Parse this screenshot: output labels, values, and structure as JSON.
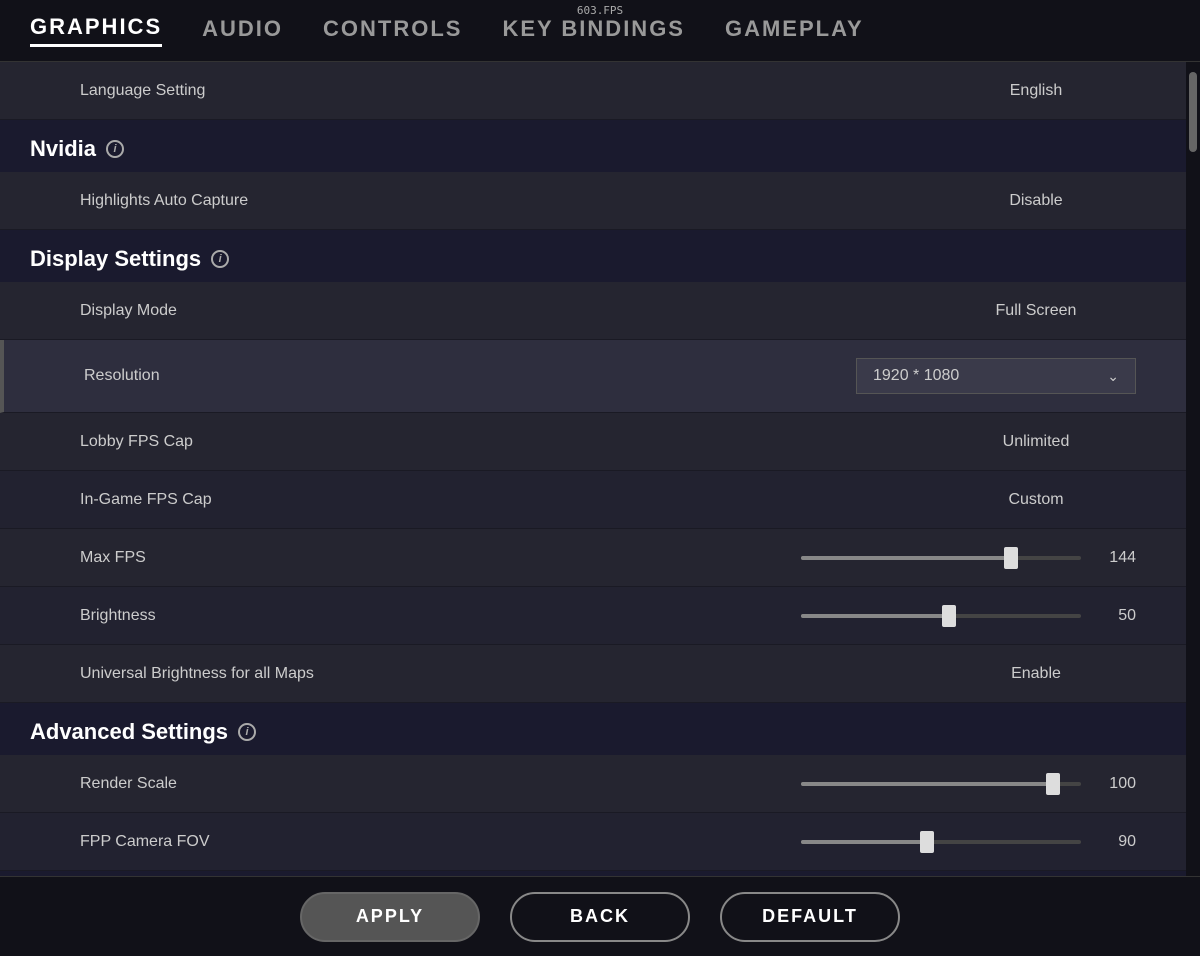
{
  "fps_counter": "603.FPS",
  "nav": {
    "tabs": [
      {
        "id": "graphics",
        "label": "GRAPHICS",
        "active": true
      },
      {
        "id": "audio",
        "label": "AUDIO",
        "active": false
      },
      {
        "id": "controls",
        "label": "CONTROLS",
        "active": false
      },
      {
        "id": "keybindings",
        "label": "KEY BINDINGS",
        "active": false
      },
      {
        "id": "gameplay",
        "label": "GAMEPLAY",
        "active": false
      }
    ]
  },
  "sections": [
    {
      "id": "general",
      "header": null,
      "rows": [
        {
          "id": "language",
          "label": "Language Setting",
          "value": "English",
          "type": "text"
        }
      ]
    },
    {
      "id": "nvidia",
      "header": "Nvidia",
      "has_info": true,
      "rows": [
        {
          "id": "highlights",
          "label": "Highlights Auto Capture",
          "value": "Disable",
          "type": "text"
        }
      ]
    },
    {
      "id": "display",
      "header": "Display Settings",
      "has_info": true,
      "rows": [
        {
          "id": "display_mode",
          "label": "Display Mode",
          "value": "Full Screen",
          "type": "text"
        },
        {
          "id": "resolution",
          "label": "Resolution",
          "value": "1920 * 1080",
          "type": "dropdown",
          "highlighted": true
        },
        {
          "id": "lobby_fps",
          "label": "Lobby FPS Cap",
          "value": "Unlimited",
          "type": "text"
        },
        {
          "id": "ingame_fps",
          "label": "In-Game FPS Cap",
          "value": "Custom",
          "type": "text"
        },
        {
          "id": "max_fps",
          "label": "Max FPS",
          "value": 144,
          "type": "slider",
          "percent": 75
        },
        {
          "id": "brightness",
          "label": "Brightness",
          "value": 50,
          "type": "slider",
          "percent": 50
        },
        {
          "id": "universal_brightness",
          "label": "Universal Brightness for all Maps",
          "value": "Enable",
          "type": "text"
        }
      ]
    },
    {
      "id": "advanced",
      "header": "Advanced Settings",
      "has_info": true,
      "rows": [
        {
          "id": "render_scale",
          "label": "Render Scale",
          "value": 100,
          "type": "slider",
          "percent": 90
        },
        {
          "id": "fpp_fov",
          "label": "FPP Camera FOV",
          "value": 90,
          "type": "slider",
          "percent": 45,
          "partial": true
        }
      ]
    }
  ],
  "buttons": {
    "apply": "APPLY",
    "back": "BACK",
    "default": "DEFAULT"
  }
}
